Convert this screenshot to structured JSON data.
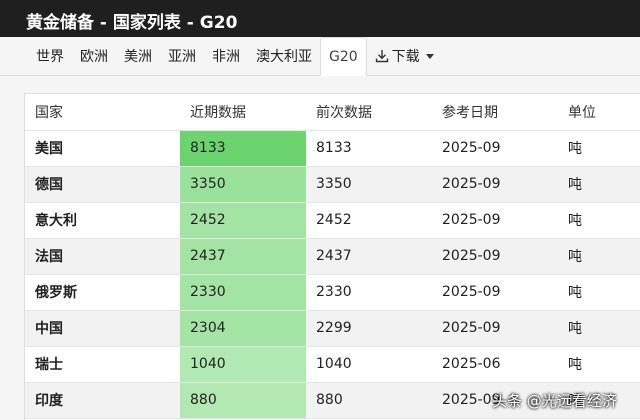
{
  "window": {
    "title": "黄金储备 - 国家列表 - G20"
  },
  "tabs": [
    {
      "label": "世界"
    },
    {
      "label": "欧洲"
    },
    {
      "label": "美洲"
    },
    {
      "label": "亚洲"
    },
    {
      "label": "非洲"
    },
    {
      "label": "澳大利亚"
    },
    {
      "label": "G20",
      "active": true
    }
  ],
  "download": {
    "label": "下载",
    "icon": "download-icon"
  },
  "table": {
    "headers": [
      "国家",
      "近期数据",
      "前次数据",
      "参考日期",
      "单位"
    ],
    "rows": [
      {
        "country": "美国",
        "latest": "8133",
        "previous": "8133",
        "date": "2025-09",
        "unit": "吨",
        "latest_value": 8133
      },
      {
        "country": "德国",
        "latest": "3350",
        "previous": "3350",
        "date": "2025-09",
        "unit": "吨",
        "latest_value": 3350
      },
      {
        "country": "意大利",
        "latest": "2452",
        "previous": "2452",
        "date": "2025-09",
        "unit": "吨",
        "latest_value": 2452
      },
      {
        "country": "法国",
        "latest": "2437",
        "previous": "2437",
        "date": "2025-09",
        "unit": "吨",
        "latest_value": 2437
      },
      {
        "country": "俄罗斯",
        "latest": "2330",
        "previous": "2330",
        "date": "2025-09",
        "unit": "吨",
        "latest_value": 2330
      },
      {
        "country": "中国",
        "latest": "2304",
        "previous": "2299",
        "date": "2025-09",
        "unit": "吨",
        "latest_value": 2304
      },
      {
        "country": "瑞士",
        "latest": "1040",
        "previous": "1040",
        "date": "2025-06",
        "unit": "吨",
        "latest_value": 1040
      },
      {
        "country": "印度",
        "latest": "880",
        "previous": "880",
        "date": "2025-09",
        "unit": "吨",
        "latest_value": 880
      }
    ],
    "heat_colors": {
      "high": "#6cd46e",
      "low": "#b2e9b3"
    }
  },
  "watermark": {
    "text": "头条 @光远看经济"
  }
}
